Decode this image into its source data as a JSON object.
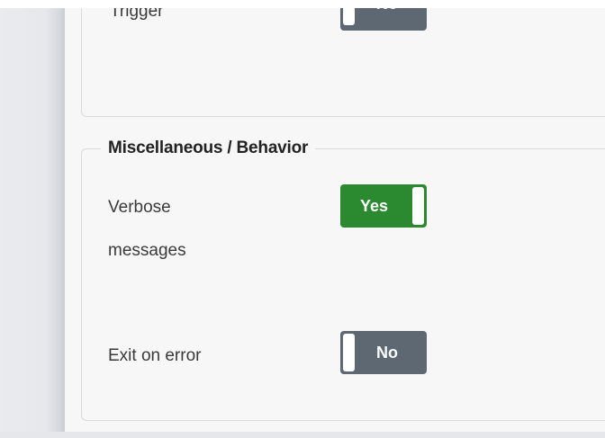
{
  "section_top": {
    "trigger_label": "Trigger",
    "trigger_toggle_text": "No"
  },
  "section_misc": {
    "legend": "Miscellaneous / Behavior",
    "verbose_label_line1": "Verbose",
    "verbose_label_line2": "messages",
    "verbose_toggle_text": "Yes",
    "exit_label": "Exit on error",
    "exit_toggle_text": "No"
  },
  "colors": {
    "toggle_on": "#2b8a2f",
    "toggle_off": "#5d6873"
  }
}
